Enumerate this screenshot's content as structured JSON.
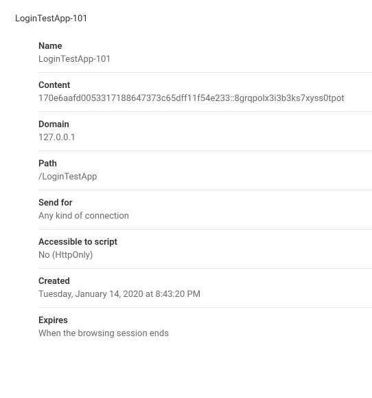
{
  "header": {
    "title": "LoginTestApp-101"
  },
  "fields": {
    "name": {
      "label": "Name",
      "value": "LoginTestApp-101"
    },
    "content": {
      "label": "Content",
      "value": "170e6aafd0053317188647373c65dff11f54e233::8grqpolx3i3b3ks7xyss0tpot"
    },
    "domain": {
      "label": "Domain",
      "value": "127.0.0.1"
    },
    "path": {
      "label": "Path",
      "value": "/LoginTestApp"
    },
    "sendfor": {
      "label": "Send for",
      "value": "Any kind of connection"
    },
    "accessible": {
      "label": "Accessible to script",
      "value": "No (HttpOnly)"
    },
    "created": {
      "label": "Created",
      "value": "Tuesday, January 14, 2020 at 8:43:20 PM"
    },
    "expires": {
      "label": "Expires",
      "value": "When the browsing session ends"
    }
  }
}
